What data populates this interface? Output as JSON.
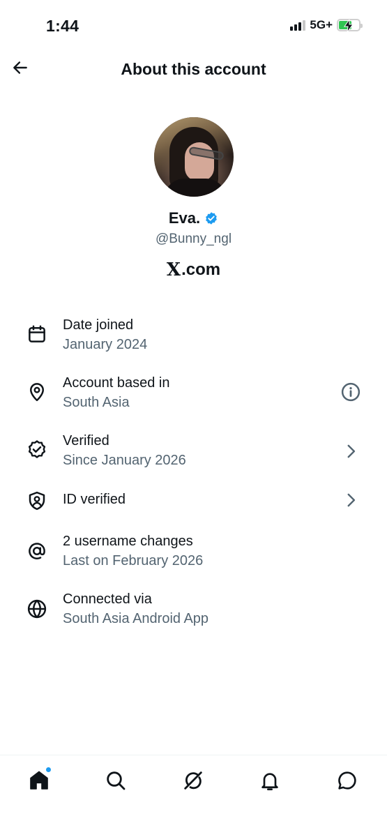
{
  "status_bar": {
    "time": "1:44",
    "network": "5G+",
    "battery_level": 0.65
  },
  "header": {
    "title": "About this account"
  },
  "profile": {
    "name": "Eva.",
    "handle": "@Bunny_ngl",
    "site": ".com",
    "site_logo": "X"
  },
  "info": [
    {
      "title": "Date joined",
      "subtitle": "January 2024",
      "icon": "calendar-icon",
      "action": null
    },
    {
      "title": "Account based in",
      "subtitle": "South Asia",
      "icon": "location-pin-icon",
      "action": "info-icon"
    },
    {
      "title": "Verified",
      "subtitle": "Since January 2026",
      "icon": "verified-badge-icon",
      "action": "chevron-right-icon"
    },
    {
      "title": "ID verified",
      "subtitle": "",
      "icon": "id-shield-icon",
      "action": "chevron-right-icon"
    },
    {
      "title": "2 username changes",
      "subtitle": "Last on February 2026",
      "icon": "at-sign-icon",
      "action": null
    },
    {
      "title": "Connected via",
      "subtitle": "South Asia Android App",
      "icon": "globe-icon",
      "action": null
    }
  ],
  "bottom_nav": [
    "home-icon",
    "search-icon",
    "grok-icon",
    "notifications-icon",
    "messages-icon"
  ],
  "colors": {
    "accent": "#1d9bf0",
    "text": "#0f1419",
    "secondary_text": "#536471",
    "battery": "#30c552"
  }
}
